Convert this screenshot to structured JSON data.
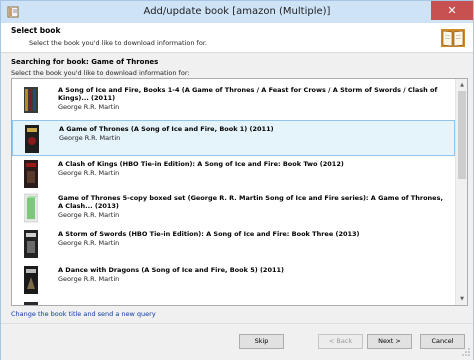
{
  "window": {
    "title": "Add/update book [amazon (Multiple)]",
    "close_glyph": "✕"
  },
  "header": {
    "title": "Select book",
    "description": "Select the book you'd like to download information for."
  },
  "search": {
    "label": "Searching for book: Game of Thrones",
    "description": "Select the book you'd like to download information for:"
  },
  "results": [
    {
      "title": "A Song of Ice and Fire, Books 1-4 (A Game of Thrones / A Feast for Crows / A Storm of Swords / Clash of Kings)... (2011)",
      "author": "George R.R. Martin",
      "selected": false
    },
    {
      "title": "A Game of Thrones (A Song of Ice and Fire, Book 1) (2011)",
      "author": "George R.R. Martin",
      "selected": true
    },
    {
      "title": "A Clash of Kings (HBO Tie-in Edition): A Song of Ice and Fire: Book Two (2012)",
      "author": "George R.R. Martin",
      "selected": false
    },
    {
      "title": "Game of Thrones 5-copy boxed set (George R. R. Martin Song of Ice and Fire series): A Game of Thrones, A Clash... (2013)",
      "author": "George R.R. Martin",
      "selected": false
    },
    {
      "title": "A Storm of Swords (HBO Tie-in Edition): A Song of Ice and Fire: Book Three (2013)",
      "author": "George R.R. Martin",
      "selected": false
    },
    {
      "title": "A Dance with Dragons (A Song of Ice and Fire, Book 5) (2011)",
      "author": "George R.R. Martin",
      "selected": false
    }
  ],
  "link": {
    "change_query": "Change the book title and send a new query"
  },
  "buttons": {
    "skip": "Skip",
    "back": "< Back",
    "next": "Next >",
    "cancel": "Cancel"
  },
  "icons": {
    "app": "book-app-icon",
    "header_logo": "open-book-icon",
    "scroll_up": "chevron-up-icon",
    "scroll_down": "chevron-down-icon"
  },
  "colors": {
    "selection_bg": "#e5f3fb",
    "selection_border": "#8fc5ec",
    "close_button": "#c75050",
    "link": "#0b3aa8"
  }
}
